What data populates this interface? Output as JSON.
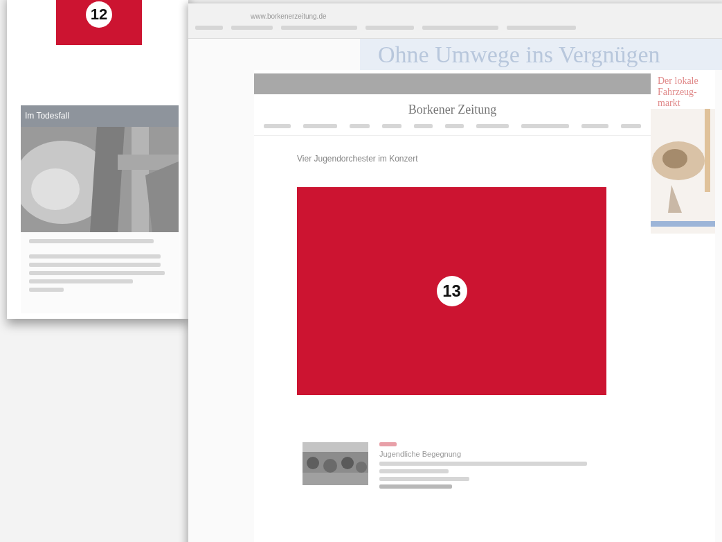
{
  "left_panel": {
    "marker": "12",
    "card": {
      "title": "Im Todesfall"
    }
  },
  "browser": {
    "url": "www.borkenerzeitung.de",
    "banner": "Ohne Umwege ins Vergnügen",
    "site": {
      "logo": "Borkener Zeitung",
      "headline": "Vier Jugendorchester im Konzert",
      "marker": "13",
      "teaser": {
        "title": "Jugendliche Begegnung"
      }
    },
    "ad": {
      "text": "Der lokale Fahrzeug-markt"
    }
  }
}
